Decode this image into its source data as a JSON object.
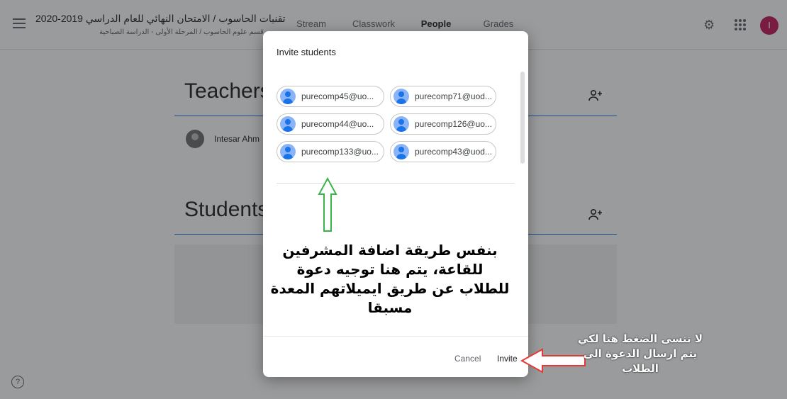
{
  "header": {
    "course_title": "تقنيات الحاسوب / الامتحان النهائي للعام الدراسي 2019-2020",
    "course_subtitle": "قسم علوم الحاسوب / المرحلة الأولى - الدراسة الصباحية",
    "tabs": [
      {
        "label": "Stream"
      },
      {
        "label": "Classwork"
      },
      {
        "label": "People"
      },
      {
        "label": "Grades"
      }
    ],
    "active_tab": "People",
    "avatar_letter": "I",
    "avatar_color": "#c2185b"
  },
  "people": {
    "teachers_title": "Teachers",
    "teacher_name": "Intesar Ahm",
    "students_title": "Students"
  },
  "dialog": {
    "title": "Invite students",
    "chips": [
      {
        "label": "purecomp45@uo..."
      },
      {
        "label": "purecomp71@uod..."
      },
      {
        "label": "purecomp44@uo..."
      },
      {
        "label": "purecomp126@uo..."
      },
      {
        "label": "purecomp133@uo..."
      },
      {
        "label": "purecomp43@uod..."
      }
    ],
    "cancel_label": "Cancel",
    "invite_label": "Invite"
  },
  "annotations": {
    "main_note": "بنفس طريقة اضافة المشرفين للقاعة، يتم هنا توجيه دعوة للطلاب عن طريق ايميلاتهم المعدة مسبقا",
    "side_note": "لا تنسى الضغط هنا لكي يتم ارسال الدعوة الى الطلاب",
    "green_arrow_color": "#3bb54a",
    "red_arrow_color": "#e53935"
  },
  "icons": [
    "menu-icon",
    "settings-icon",
    "apps-icon",
    "add-person-icon",
    "help-icon"
  ]
}
